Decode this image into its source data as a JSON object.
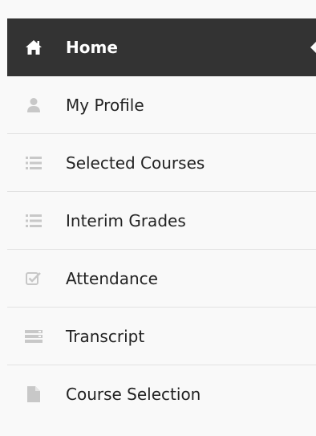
{
  "sidebar": {
    "items": [
      {
        "label": "Home",
        "icon": "home-icon",
        "active": true
      },
      {
        "label": "My Profile",
        "icon": "user-icon",
        "active": false
      },
      {
        "label": "Selected Courses",
        "icon": "list-icon",
        "active": false
      },
      {
        "label": "Interim Grades",
        "icon": "list-icon",
        "active": false
      },
      {
        "label": "Attendance",
        "icon": "checkbox-icon",
        "active": false
      },
      {
        "label": "Transcript",
        "icon": "transcript-icon",
        "active": false
      },
      {
        "label": "Course Selection",
        "icon": "document-icon",
        "active": false
      }
    ]
  },
  "colors": {
    "active_bg": "#333333",
    "active_text": "#ffffff",
    "text": "#222222",
    "icon_muted": "#c8c8c8",
    "divider": "#e2e2e2",
    "page_bg": "#f9f9f9"
  }
}
